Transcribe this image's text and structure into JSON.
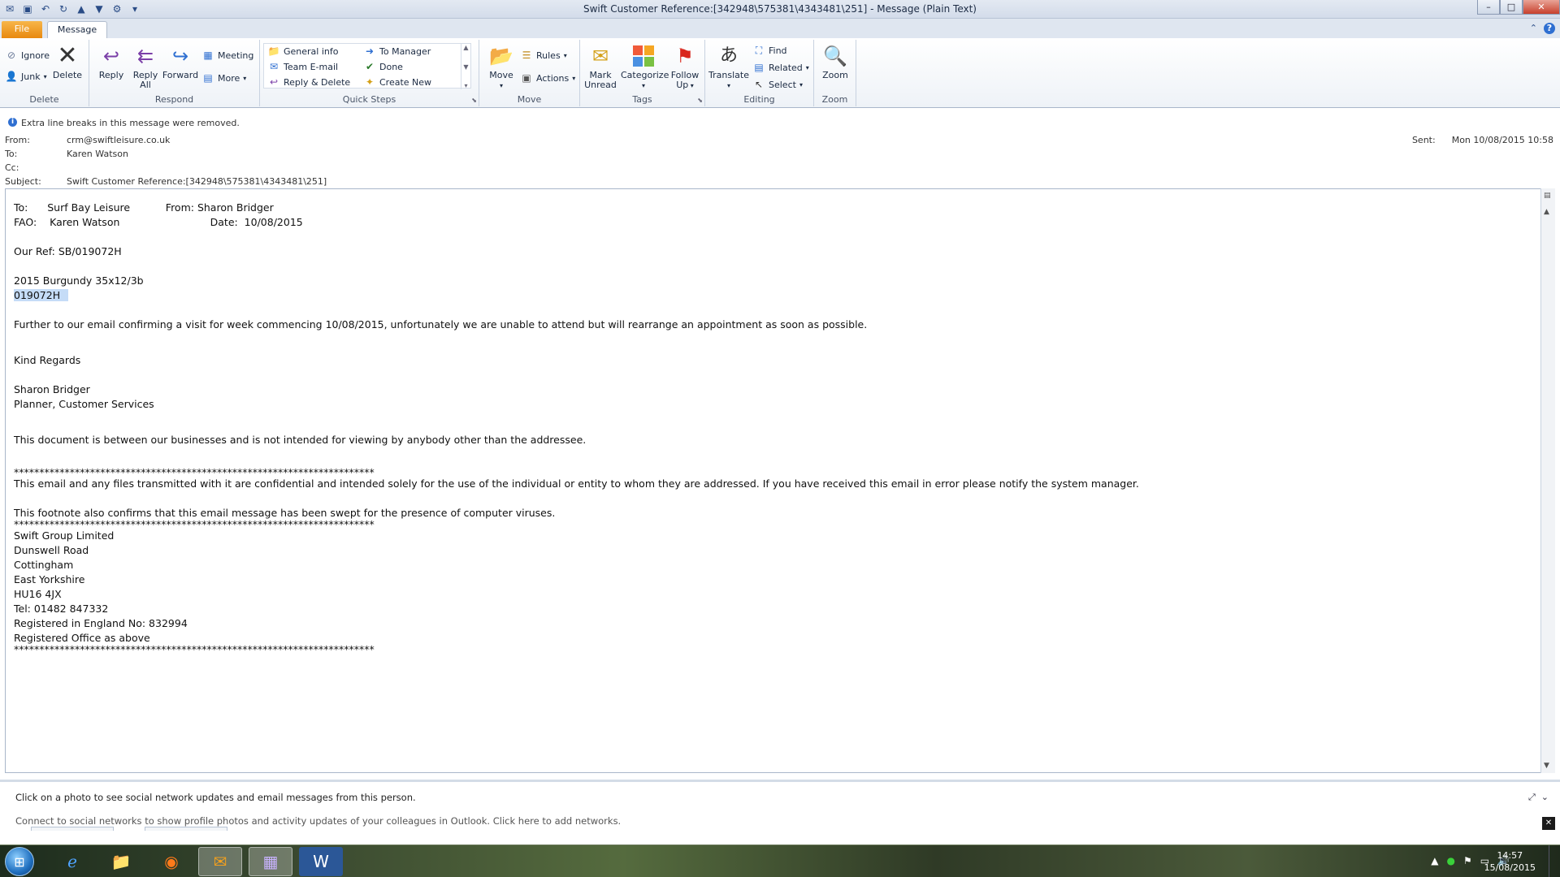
{
  "window": {
    "title": "Swift Customer Reference:[342948\\575381\\4343481\\251]  -  Message (Plain Text)"
  },
  "tabs": {
    "file": "File",
    "message": "Message"
  },
  "ribbon": {
    "delete": {
      "label": "Delete",
      "ignore": "Ignore",
      "junk": "Junk",
      "delete_btn": "Delete"
    },
    "respond": {
      "label": "Respond",
      "reply": "Reply",
      "reply_all_1": "Reply",
      "reply_all_2": "All",
      "forward": "Forward",
      "meeting": "Meeting",
      "more": "More"
    },
    "quick_steps": {
      "label": "Quick Steps",
      "general_info": "General info",
      "team_email": "Team E-mail",
      "reply_delete": "Reply & Delete",
      "to_manager": "To Manager",
      "done": "Done",
      "create_new": "Create New"
    },
    "move": {
      "label": "Move",
      "move_btn": "Move",
      "rules": "Rules",
      "actions": "Actions"
    },
    "tags": {
      "label": "Tags",
      "mark_unread_1": "Mark",
      "mark_unread_2": "Unread",
      "categorize": "Categorize",
      "follow_up_1": "Follow",
      "follow_up_2": "Up"
    },
    "editing": {
      "label": "Editing",
      "translate": "Translate",
      "find": "Find",
      "related": "Related",
      "select": "Select"
    },
    "zoom": {
      "label": "Zoom",
      "zoom_btn": "Zoom"
    }
  },
  "message": {
    "info": "Extra line breaks in this message were removed.",
    "from_label": "From:",
    "from": "crm@swiftleisure.co.uk",
    "to_label": "To:",
    "to": "Karen Watson",
    "cc_label": "Cc:",
    "cc": "",
    "subject_label": "Subject:",
    "subject": "Swift Customer Reference:[342948\\575381\\4343481\\251]",
    "sent_label": "Sent:",
    "sent": "Mon 10/08/2015 10:58"
  },
  "body": {
    "l1": "To:      Surf Bay Leisure           From: Sharon Bridger",
    "l2": "FAO:    Karen Watson                            Date:  10/08/2015",
    "l3": "Our Ref: SB/019072H",
    "l4": "2015 Burgundy 35x12/3b",
    "l5": "019072H",
    "l6": "Further to our email confirming a visit for week commencing 10/08/2015, unfortunately we are unable to attend but will rearrange an appointment as soon as possible.",
    "l7": "Kind Regards",
    "l8": "Sharon Bridger",
    "l9": "Planner, Customer Services",
    "l10": "This document is between our businesses and is not intended for viewing by anybody other than the addressee.",
    "stars": "***********************************************************************",
    "l11": "This email and any files transmitted with it are confidential and intended solely for the use of the individual or entity to whom they are addressed. If you have received this email in error please notify the system manager.",
    "l12": "This footnote also confirms that this email message has been swept for the presence of computer viruses.",
    "a1": "Swift Group Limited",
    "a2": "Dunswell Road",
    "a3": "Cottingham",
    "a4": "East Yorkshire",
    "a5": "HU16 4JX",
    "a6": "Tel: 01482 847332",
    "a7": "Registered in England No: 832994",
    "a8": "Registered Office as above"
  },
  "people_pane": {
    "line1": "Click on a photo to see social network updates and email messages from this person.",
    "line2": "Connect to social networks to show profile photos and activity updates of your colleagues in Outlook. Click here to add networks."
  },
  "taskbar": {
    "time": "14:57",
    "date": "15/08/2015"
  },
  "colors": {
    "file_tab": "#e8890f",
    "selection": "#c5dcf7",
    "accent": "#2f6fd1"
  }
}
